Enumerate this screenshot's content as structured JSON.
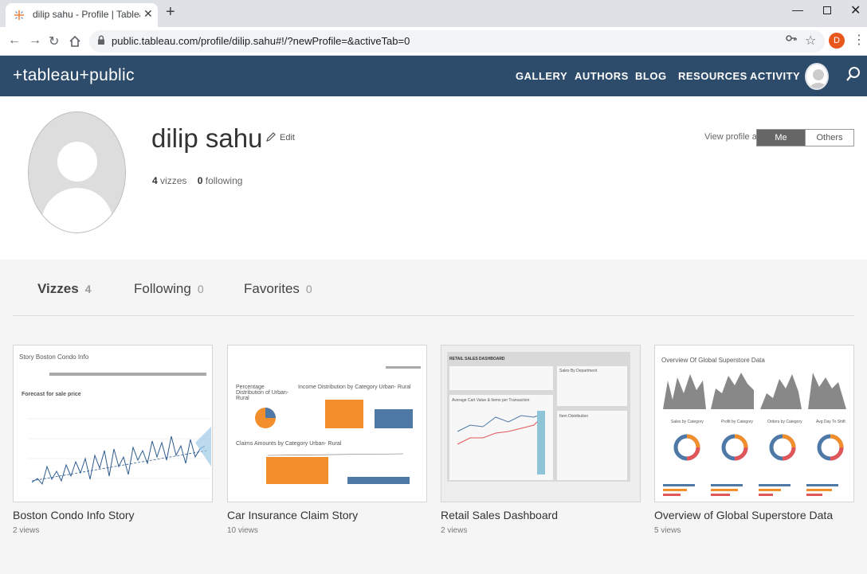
{
  "browser": {
    "tab_title": "dilip sahu - Profile | Tableau Publ",
    "url": "public.tableau.com/profile/dilip.sahu#!/?newProfile=&activeTab=0",
    "profile_initial": "D"
  },
  "header": {
    "logo": "+tableau+public",
    "nav": [
      "GALLERY",
      "AUTHORS",
      "BLOG",
      "RESOURCES",
      "ACTIVITY"
    ]
  },
  "profile": {
    "name": "dilip sahu",
    "edit_label": "Edit",
    "vizzes_count": "4",
    "vizzes_label": "vizzes",
    "following_count": "0",
    "following_label": "following",
    "view_as_label": "View profile as",
    "view_me": "Me",
    "view_others": "Others"
  },
  "tabs": [
    {
      "label": "Vizzes",
      "count": "4"
    },
    {
      "label": "Following",
      "count": "0"
    },
    {
      "label": "Favorites",
      "count": "0"
    }
  ],
  "cards": [
    {
      "title": "Boston Condo Info Story",
      "views": "2 views",
      "thumb_heading": "Story Boston Condo Info",
      "thumb_sub": "Forecast for sale price"
    },
    {
      "title": "Car Insurance Claim Story",
      "views": "10 views",
      "thumb_heading": "Percentage Distribution of Urban- Rural",
      "thumb_sub": "Income Distribution by Category Urban- Rural",
      "thumb_sub2": "Claims Amounts by Category Urban- Rural"
    },
    {
      "title": "Retail Sales Dashboard",
      "views": "2 views",
      "thumb_heading": "RETAIL SALES DASHBOARD",
      "thumb_sub": "Average Cart Value & Items per Transaction",
      "thumb_sub2": "Sales By Department",
      "thumb_sub3": "Item Distribution"
    },
    {
      "title": "Overview of Global Superstore Data",
      "views": "5 views",
      "thumb_heading": "Overview Of Global Superstore Data",
      "thumb_sub": "Sales by Category",
      "thumb_sub2": "Profit by Category",
      "thumb_sub3": "Orders by Category",
      "thumb_sub4": "Avg Day To Shift"
    }
  ],
  "colors": {
    "header_bg": "#2d4b6a",
    "orange": "#f28e2b",
    "blue": "#4e79a7"
  }
}
